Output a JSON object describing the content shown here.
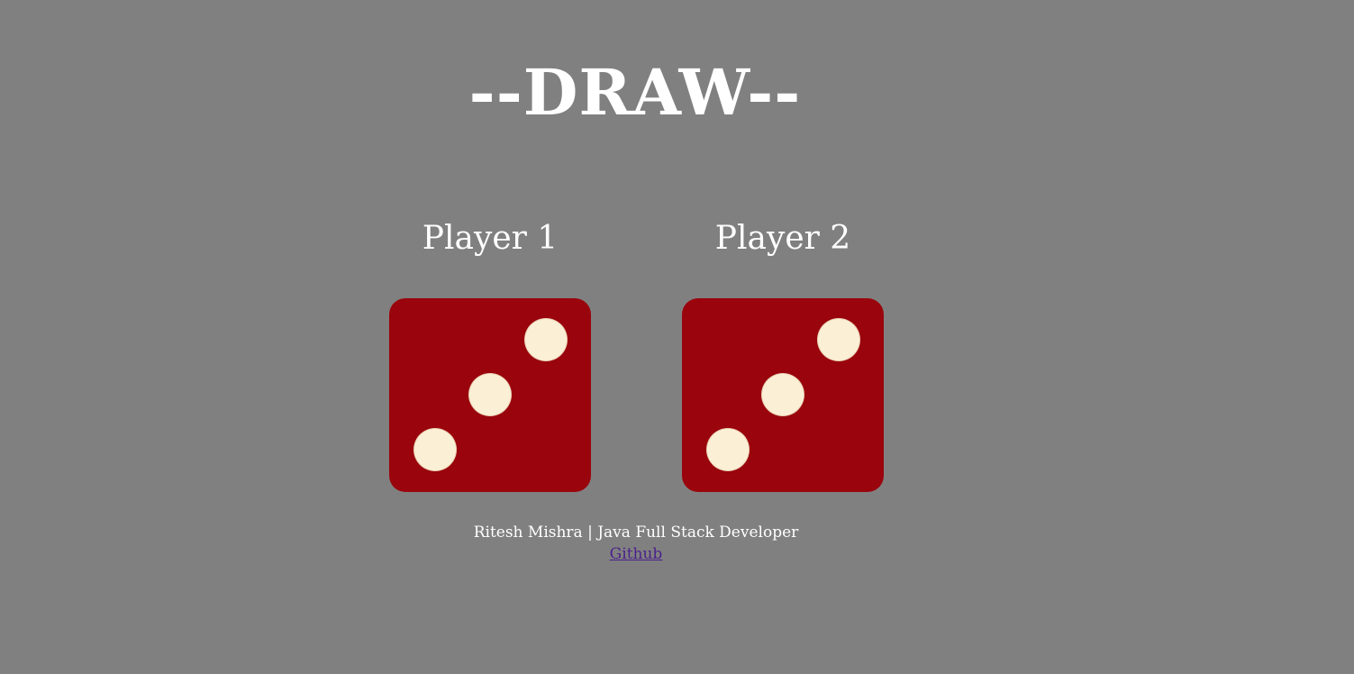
{
  "title": "--DRAW--",
  "players": [
    {
      "label": "Player 1",
      "die_value": 3
    },
    {
      "label": "Player 2",
      "die_value": 3
    }
  ],
  "footer": {
    "credit": "Ritesh Mishra | Java Full Stack Developer",
    "link_label": "Github"
  },
  "colors": {
    "background": "#808080",
    "die_face": "#9a040c",
    "pip": "#fbefd6",
    "text": "#ffffff",
    "link": "#4b1f8c"
  }
}
